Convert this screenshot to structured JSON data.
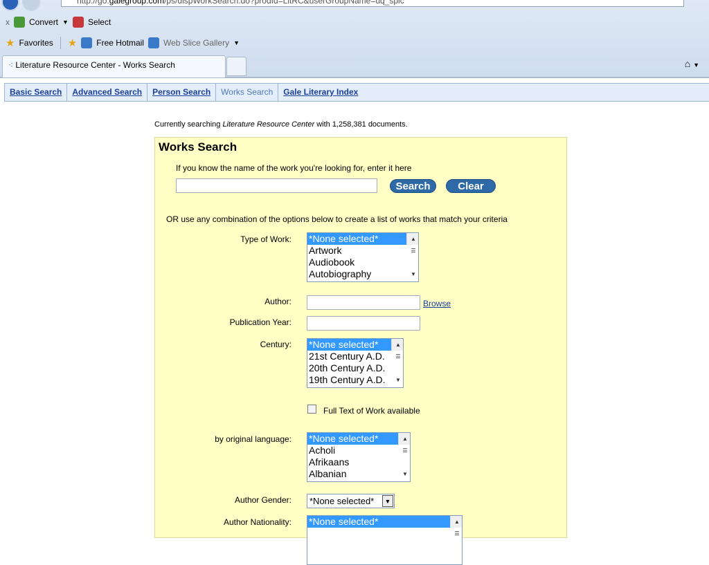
{
  "browser": {
    "url_prefix": "http://go.",
    "url_domain": "galegroup.com",
    "url_rest": "/ps/dispWorkSearch.do?prodId=LitRC&userGroupName=uq_spic",
    "command_bar": {
      "close": "x",
      "convert": "Convert",
      "select": "Select"
    },
    "favorites_bar": {
      "favorites": "Favorites",
      "free_hotmail": "Free Hotmail",
      "web_slice_gallery": "Web Slice Gallery"
    },
    "tab_title": "Literature Resource Center - Works Search"
  },
  "nav": [
    "Basic Search",
    "Advanced Search",
    "Person Search",
    "Works Search",
    "Gale Literary Index"
  ],
  "status": {
    "prefix": "Currently searching",
    "db": "Literature Resource Center",
    "mid": "with",
    "count": "1,258,381",
    "suffix": "documents."
  },
  "form": {
    "title": "Works Search",
    "intro": "If you know the name of the work you're looking for, enter it here",
    "work_name_value": "",
    "search": "Search",
    "clear": "Clear",
    "or_text": "OR use any combination of the options below to create a list of works that match your criteria",
    "type_label": "Type of Work:",
    "type_options": [
      "*None selected*",
      "Artwork",
      "Audiobook",
      "Autobiography"
    ],
    "author_label": "Author:",
    "author_value": "",
    "browse": "Browse",
    "year_label": "Publication Year:",
    "year_value": "",
    "century_label": "Century:",
    "century_options": [
      "*None selected*",
      "21st Century A.D.",
      "20th Century A.D.",
      "19th Century A.D."
    ],
    "fulltext_label": "Full Text of Work available",
    "language_label": "by original language:",
    "language_options": [
      "*None selected*",
      "Acholi",
      "Afrikaans",
      "Albanian"
    ],
    "gender_label": "Author Gender:",
    "gender_value": "*None selected*",
    "nationality_label": "Author Nationality:",
    "nationality_options": [
      "*None selected*"
    ]
  }
}
